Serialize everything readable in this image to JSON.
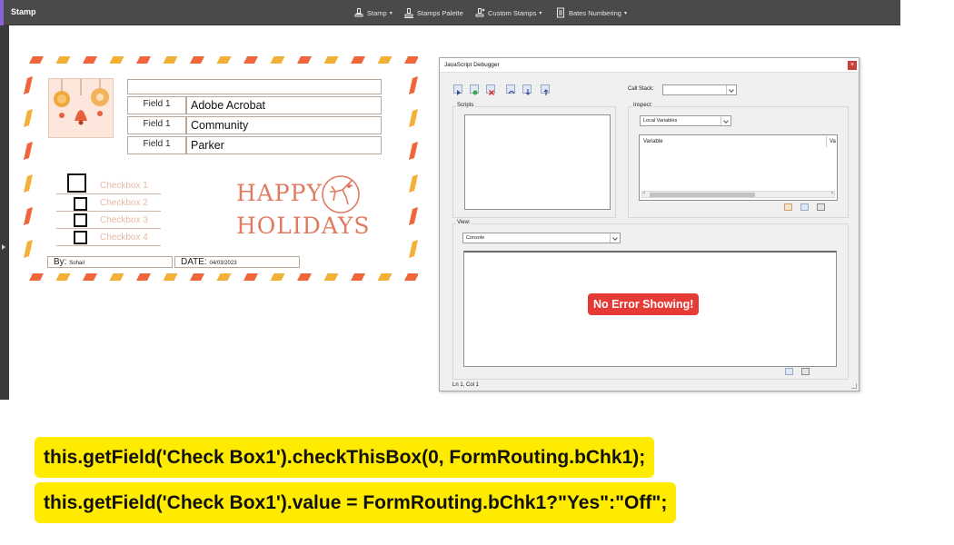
{
  "toolbar": {
    "title": "Stamp",
    "items": [
      {
        "label": "Stamp",
        "icon": "stamp-icon"
      },
      {
        "label": "Stamps Palette",
        "icon": "stamps-palette-icon"
      },
      {
        "label": "Custom Stamps",
        "icon": "custom-stamps-icon"
      },
      {
        "label": "Bates Numbering",
        "icon": "bates-numbering-icon"
      }
    ]
  },
  "stamp": {
    "fields": [
      {
        "label": "Field 1",
        "value": "Adobe Acrobat"
      },
      {
        "label": "Field 1",
        "value": "Community"
      },
      {
        "label": "Field 1",
        "value": "Parker"
      }
    ],
    "checkboxes": [
      "Checkbox 1",
      "Checkbox 2",
      "Checkbox 3",
      "Checkbox 4"
    ],
    "greeting_line1": "HAPPY",
    "greeting_line2": "HOLIDAYS",
    "by_label": "By:",
    "by_value": "Sohail",
    "date_label": "DATE:",
    "date_value": "04/03/2023",
    "colors": {
      "stripe_orange": "#f0653a",
      "stripe_gold": "#f2b136",
      "text_coral": "#e07b62"
    }
  },
  "debugger": {
    "title": "JavaScript Debugger",
    "call_stack_label": "Call Stack:",
    "scripts_label": "Scripts",
    "inspect_label": "Inspect:",
    "inspect_select": "Local Variables",
    "variable_col": "Variable",
    "value_col": "Va",
    "view_label": "View:",
    "view_select": "Console",
    "status": "Ln 1, Col 1"
  },
  "annotation": {
    "error_badge": "No Error Showing!",
    "code_line1": "this.getField('Check Box1').checkThisBox(0, FormRouting.bChk1);",
    "code_line2": "this.getField('Check Box1').value = FormRouting.bChk1?\"Yes\":\"Off\";",
    "highlight_color": "#ffeb00",
    "badge_color": "#e53a35"
  }
}
